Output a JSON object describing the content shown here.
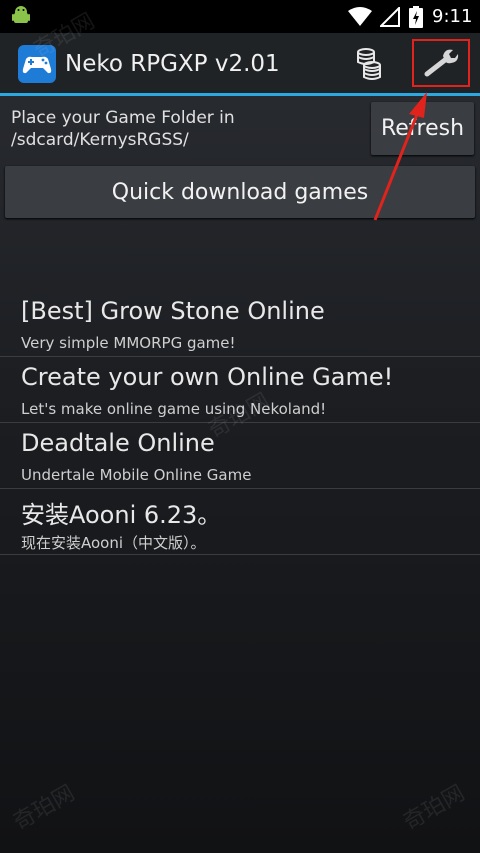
{
  "status_bar": {
    "time": "9:11",
    "icons": [
      "android-icon",
      "wifi-icon",
      "signal-icon",
      "battery-icon"
    ]
  },
  "action_bar": {
    "title": "Neko RPGXP v2.01",
    "logo_icon": "gamepad-icon",
    "coins_icon": "coins-icon",
    "settings_icon": "wrench-icon",
    "accent_color": "#2ba9e0",
    "highlight_color": "#e0231c"
  },
  "folder_info": {
    "line1": "Place your Game Folder in",
    "line2": "/sdcard/KernysRGSS/"
  },
  "buttons": {
    "refresh_label": "Refresh",
    "quick_download_label": "Quick download games"
  },
  "games": [
    {
      "title": "[Best] Grow Stone Online",
      "description": "Very simple MMORPG game!"
    },
    {
      "title": "Create your own Online Game!",
      "description": "Let's make online game using Nekoland!"
    },
    {
      "title": "Deadtale Online",
      "description": "Undertale Mobile Online Game"
    },
    {
      "title": "安装Aooni 6.23。",
      "description": "现在安装Aooni（中文版）。"
    }
  ],
  "watermark": {
    "text": "奇珀网"
  }
}
